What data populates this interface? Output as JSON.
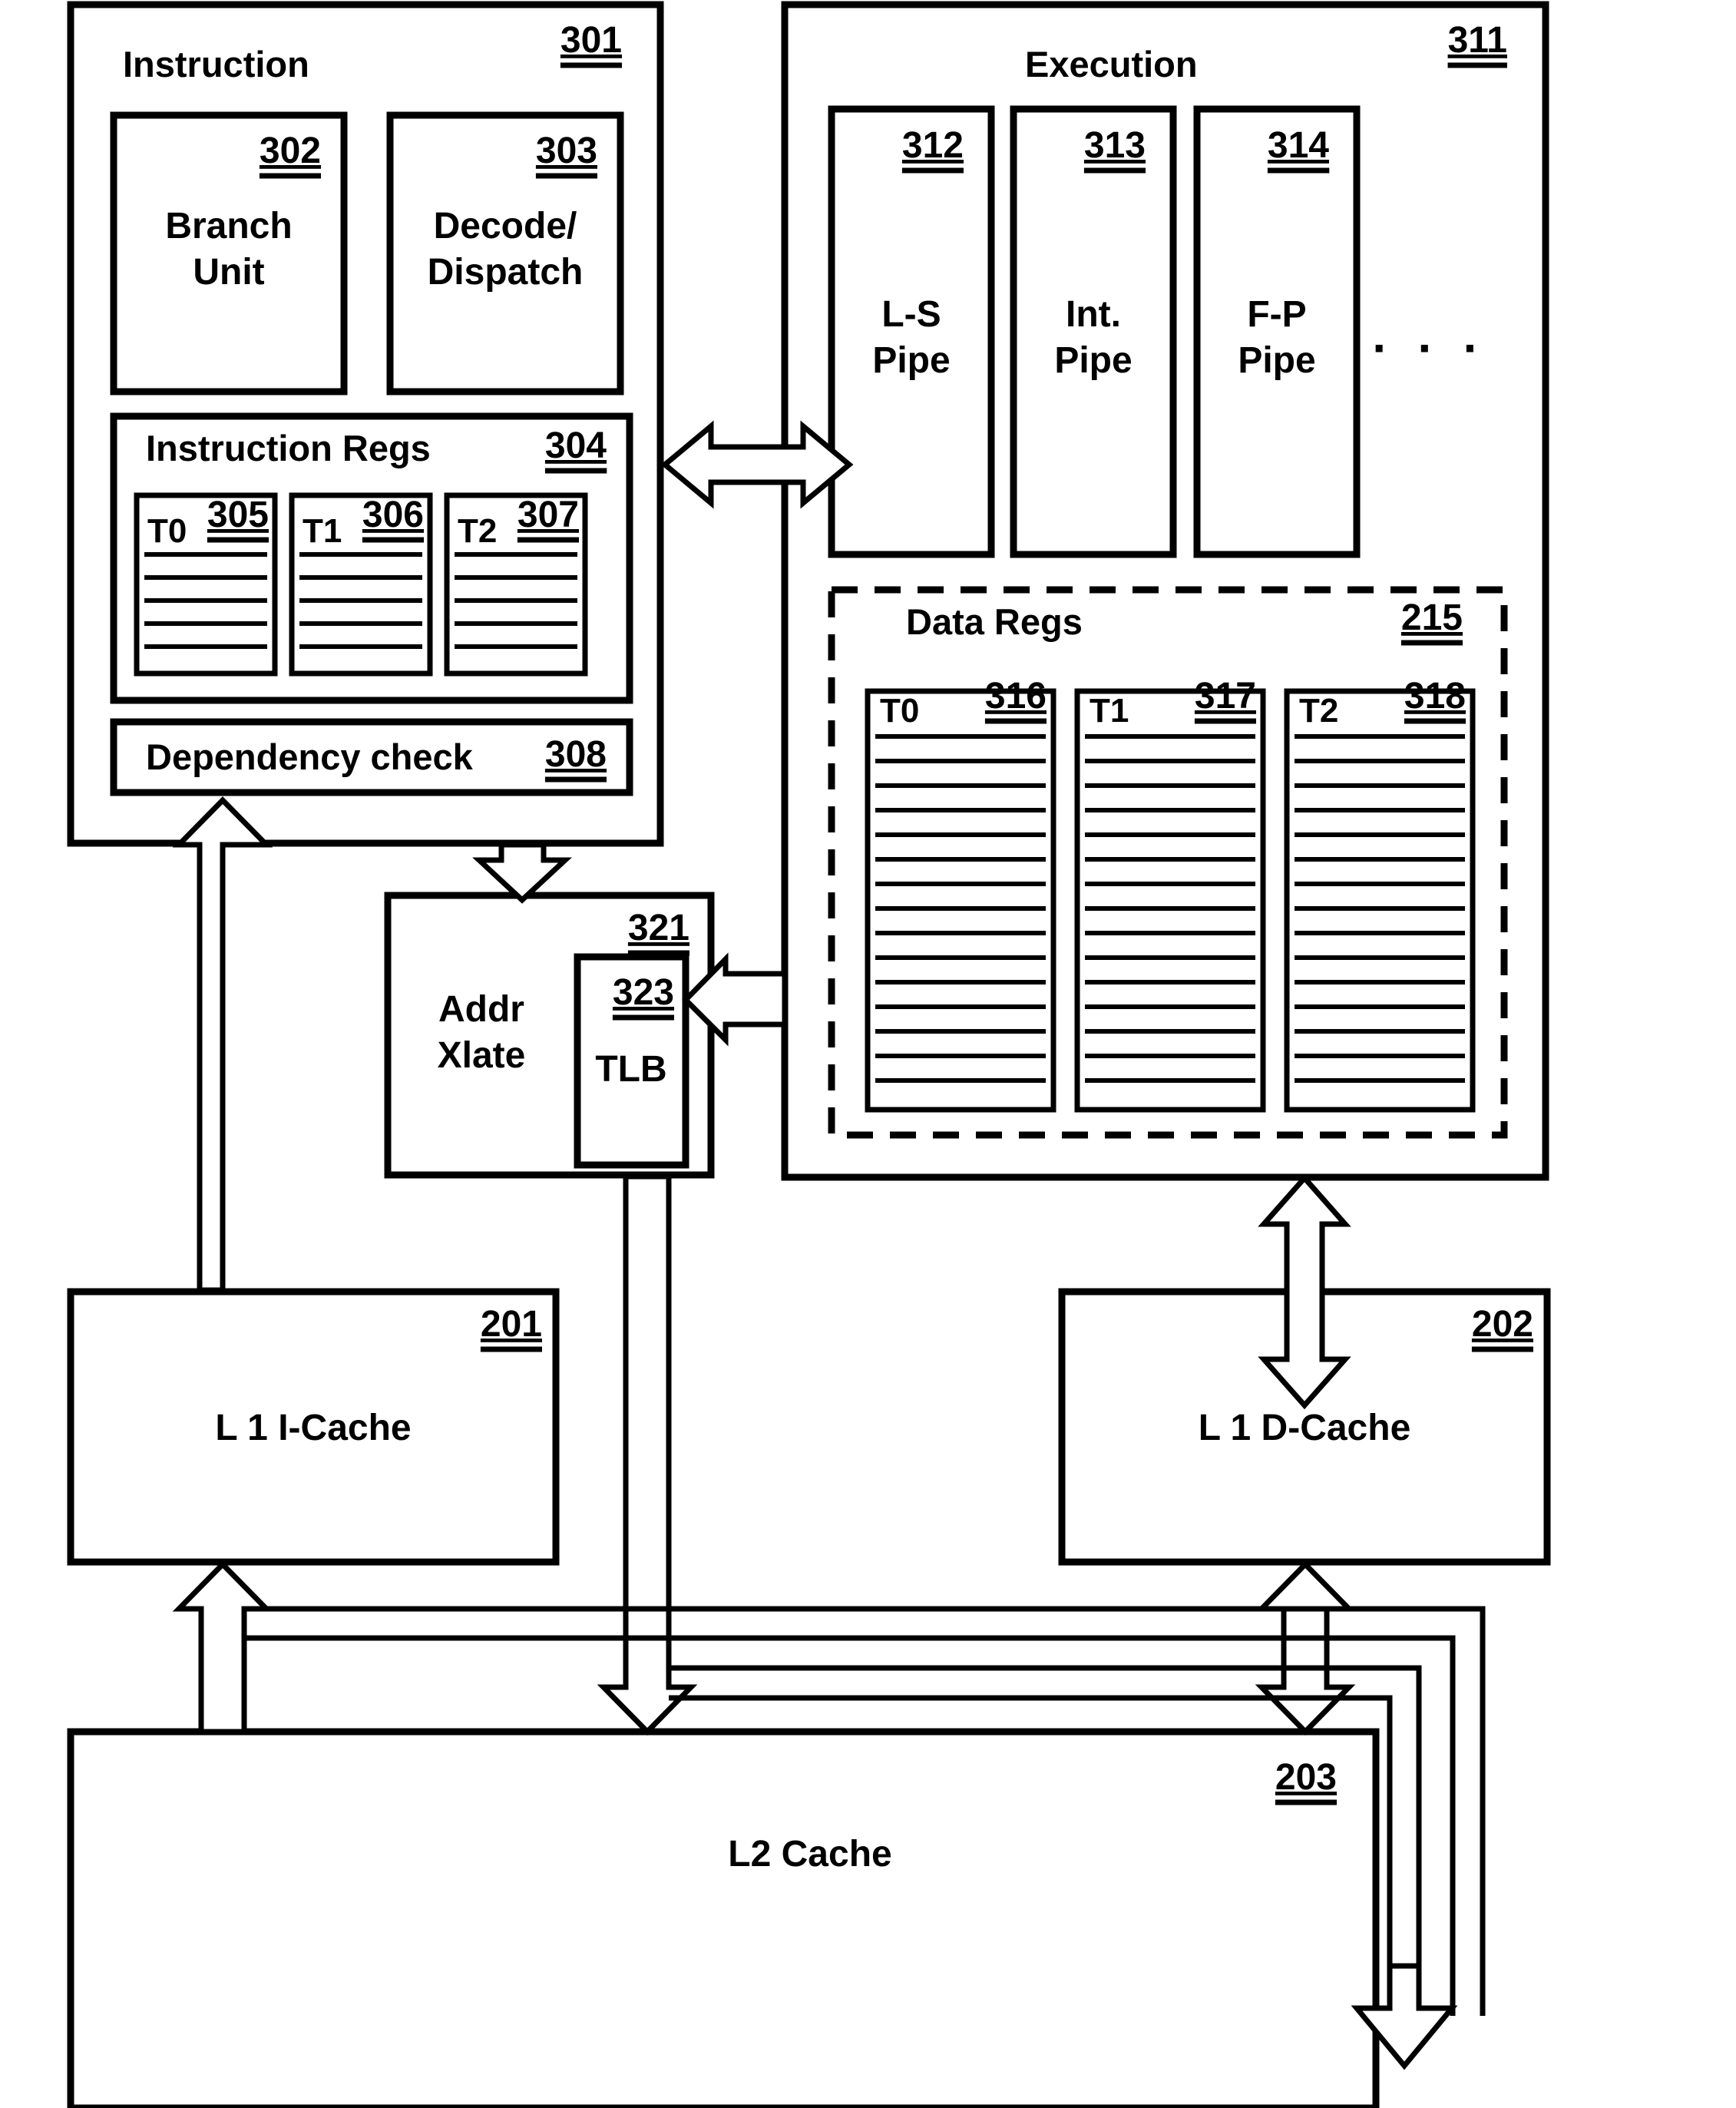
{
  "figure": {
    "type": "processor-block-diagram",
    "blocks": {
      "instruction_unit": {
        "label": "Instruction",
        "ref": "301",
        "children": {
          "branch_unit": {
            "label_line1": "Branch",
            "label_line2": "Unit",
            "ref": "302"
          },
          "decode_dispatch": {
            "label_line1": "Decode/",
            "label_line2": "Dispatch",
            "ref": "303"
          },
          "instruction_regs": {
            "label": "Instruction Regs",
            "ref": "304",
            "registers": [
              {
                "label": "T0",
                "ref": "305",
                "lines": 5
              },
              {
                "label": "T1",
                "ref": "306",
                "lines": 5
              },
              {
                "label": "T2",
                "ref": "307",
                "lines": 5
              }
            ]
          },
          "dependency_check": {
            "label": "Dependency check",
            "ref": "308"
          }
        }
      },
      "execution_unit": {
        "label": "Execution",
        "ref": "311",
        "pipes": [
          {
            "label_line1": "L-S",
            "label_line2": "Pipe",
            "ref": "312"
          },
          {
            "label_line1": "Int.",
            "label_line2": "Pipe",
            "ref": "313"
          },
          {
            "label_line1": "F-P",
            "label_line2": "Pipe",
            "ref": "314"
          }
        ],
        "pipes_ellipsis": "· · ·",
        "data_regs": {
          "label": "Data Regs",
          "ref": "215",
          "registers": [
            {
              "label": "T0",
              "ref": "316",
              "lines": 16
            },
            {
              "label": "T1",
              "ref": "317",
              "lines": 16
            },
            {
              "label": "T2",
              "ref": "318",
              "lines": 16
            }
          ]
        }
      },
      "addr_xlate": {
        "label_line1": "Addr",
        "label_line2": "Xlate",
        "ref": "321",
        "tlb": {
          "label": "TLB",
          "ref": "323"
        }
      },
      "l1_icache": {
        "label": "L 1  I-Cache",
        "ref": "201"
      },
      "l1_dcache": {
        "label": "L 1  D-Cache",
        "ref": "202"
      },
      "l2_cache": {
        "label": "L2 Cache",
        "ref": "203"
      }
    },
    "colors": {
      "stroke": "#000000",
      "fill": "#ffffff"
    }
  }
}
